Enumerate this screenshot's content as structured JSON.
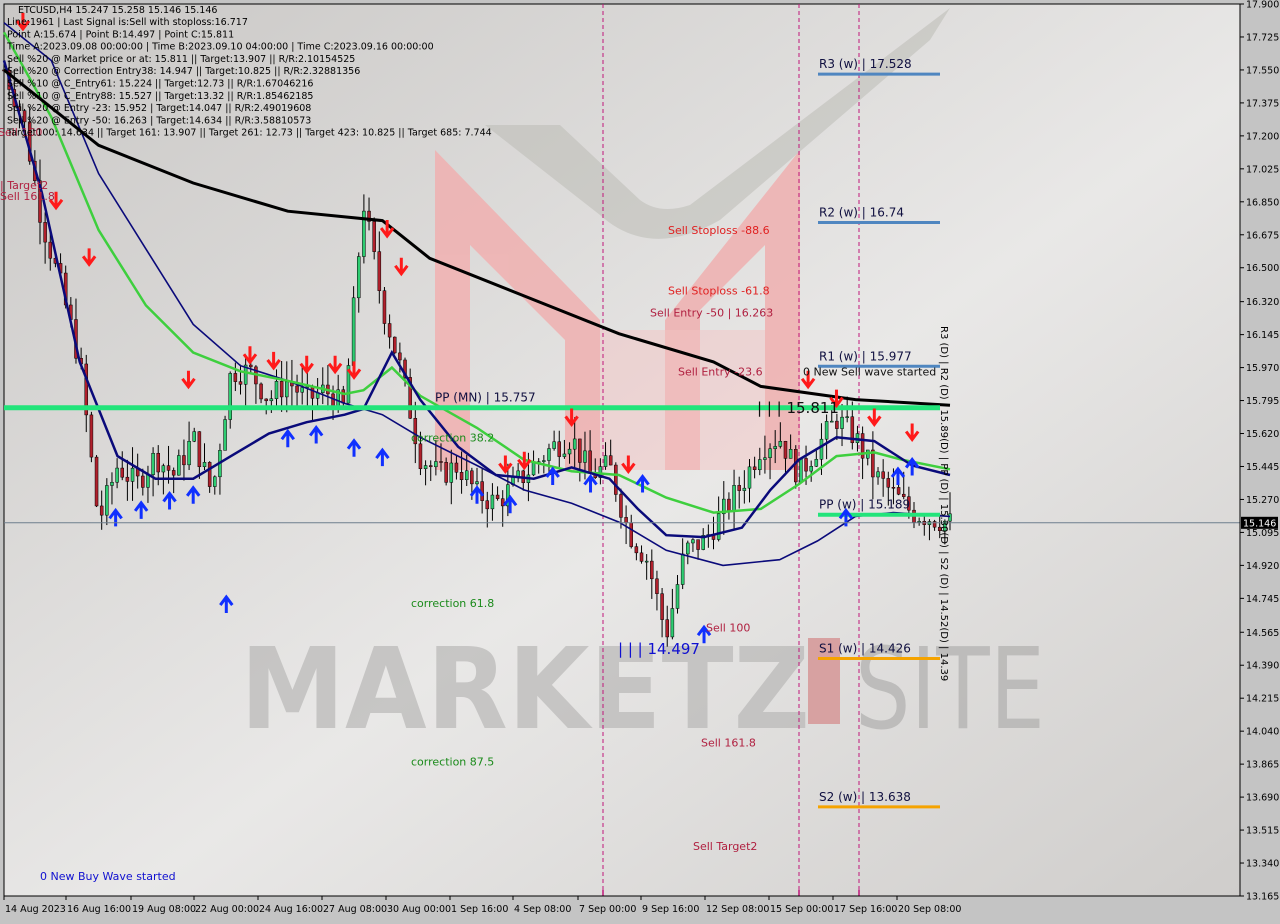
{
  "header": {
    "symbol_line": "ETCUSD,H4  15.247 15.258 15.146 15.146",
    "info_lines": [
      "Line:1961 | Last Signal is:Sell with stoploss:16.717",
      "Point A:15.674 | Point B:14.497 | Point C:15.811",
      "Time A:2023.09.08 00:00:00 | Time B:2023.09.10 04:00:00 | Time C:2023.09.16 00:00:00",
      "Sell %20 @ Market price or at: 15.811 || Target:13.907 || R/R:2.10154525",
      "Sell %20 @ Correction Entry38: 14.947 || Target:10.825 || R/R:2.32881356",
      "Sell %10 @ C_Entry61: 15.224 || Target:12.73 || R/R:1.67046216",
      "Sell %10 @ C_Entry88: 15.527 || Target:13.32 || R/R:1.85462185",
      "Sell %20 @ Entry -23: 15.952 | Target:14.047 || R/R:2.49019608",
      "Sell %20 @ Entry -50: 16.263 | Target:14.634 || R/R:3.58810573",
      "Target100: 14.634 || Target 161: 13.907 || Target 261: 12.73 || Target 423: 10.825 || Target 685: 7.744"
    ]
  },
  "watermark": {
    "left": "MARKETZ",
    "right": "SITE"
  },
  "colors": {
    "background": "#d6d4d2",
    "bull_candle": "#2ecc71",
    "bear_candle": "#b0202c",
    "ma_black": "#000000",
    "ma_navy": "#0a0a7a",
    "ma_green": "#3ecf3e",
    "pivot_weekly_r": "#4f86c0",
    "pivot_weekly_s": "#f5a300",
    "pivot_green": "#22e47a",
    "vline": "#c0167a",
    "sell_text": "#d42020",
    "correction_text": "#1a8a1a",
    "buy_text": "#1010d0",
    "current_price_bg": "#000000"
  },
  "chart_data": {
    "type": "candlestick",
    "title": "ETCUSD,H4",
    "ylim": [
      13.165,
      17.9
    ],
    "y_ticks": [
      "17.900",
      "17.725",
      "17.550",
      "17.375",
      "17.200",
      "17.025",
      "16.850",
      "16.675",
      "16.500",
      "16.320",
      "16.145",
      "15.970",
      "15.795",
      "15.620",
      "15.445",
      "15.270",
      "15.095",
      "14.920",
      "14.745",
      "14.565",
      "14.390",
      "14.215",
      "14.040",
      "13.865",
      "13.690",
      "13.515",
      "13.340",
      "13.165"
    ],
    "x_ticks": [
      "14 Aug 2023",
      "16 Aug 16:00",
      "19 Aug 08:00",
      "22 Aug 00:00",
      "24 Aug 16:00",
      "27 Aug 08:00",
      "30 Aug 00:00",
      "1 Sep 16:00",
      "4 Sep 08:00",
      "7 Sep 00:00",
      "9 Sep 16:00",
      "12 Sep 08:00",
      "15 Sep 00:00",
      "17 Sep 16:00",
      "20 Sep 08:00"
    ],
    "current_price": "15.146",
    "ohlc_last": {
      "open": 15.247,
      "high": 15.258,
      "low": 15.146,
      "close": 15.146
    },
    "close_path": [
      {
        "t": 0.0,
        "c": 17.55
      },
      {
        "t": 0.02,
        "c": 17.3
      },
      {
        "t": 0.04,
        "c": 16.75
      },
      {
        "t": 0.06,
        "c": 16.4
      },
      {
        "t": 0.08,
        "c": 16.0
      },
      {
        "t": 0.1,
        "c": 15.15
      },
      {
        "t": 0.12,
        "c": 15.45
      },
      {
        "t": 0.14,
        "c": 15.35
      },
      {
        "t": 0.16,
        "c": 15.5
      },
      {
        "t": 0.18,
        "c": 15.4
      },
      {
        "t": 0.2,
        "c": 15.6
      },
      {
        "t": 0.22,
        "c": 15.3
      },
      {
        "t": 0.24,
        "c": 15.95
      },
      {
        "t": 0.26,
        "c": 15.95
      },
      {
        "t": 0.28,
        "c": 15.8
      },
      {
        "t": 0.3,
        "c": 15.9
      },
      {
        "t": 0.32,
        "c": 15.8
      },
      {
        "t": 0.34,
        "c": 15.85
      },
      {
        "t": 0.36,
        "c": 15.75
      },
      {
        "t": 0.38,
        "c": 16.85
      },
      {
        "t": 0.4,
        "c": 16.3
      },
      {
        "t": 0.42,
        "c": 15.95
      },
      {
        "t": 0.44,
        "c": 15.5
      },
      {
        "t": 0.46,
        "c": 15.4
      },
      {
        "t": 0.48,
        "c": 15.45
      },
      {
        "t": 0.5,
        "c": 15.3
      },
      {
        "t": 0.52,
        "c": 15.25
      },
      {
        "t": 0.54,
        "c": 15.35
      },
      {
        "t": 0.56,
        "c": 15.45
      },
      {
        "t": 0.58,
        "c": 15.55
      },
      {
        "t": 0.6,
        "c": 15.6
      },
      {
        "t": 0.62,
        "c": 15.4
      },
      {
        "t": 0.64,
        "c": 15.45
      },
      {
        "t": 0.66,
        "c": 15.1
      },
      {
        "t": 0.68,
        "c": 14.95
      },
      {
        "t": 0.7,
        "c": 14.55
      },
      {
        "t": 0.72,
        "c": 15.0
      },
      {
        "t": 0.74,
        "c": 15.05
      },
      {
        "t": 0.76,
        "c": 15.2
      },
      {
        "t": 0.78,
        "c": 15.35
      },
      {
        "t": 0.8,
        "c": 15.55
      },
      {
        "t": 0.82,
        "c": 15.6
      },
      {
        "t": 0.84,
        "c": 15.4
      },
      {
        "t": 0.86,
        "c": 15.55
      },
      {
        "t": 0.88,
        "c": 15.7
      },
      {
        "t": 0.9,
        "c": 15.6
      },
      {
        "t": 0.92,
        "c": 15.4
      },
      {
        "t": 0.94,
        "c": 15.3
      },
      {
        "t": 0.96,
        "c": 15.2
      },
      {
        "t": 1.0,
        "c": 15.146
      }
    ],
    "ma_black": [
      [
        0.0,
        17.55
      ],
      [
        0.1,
        17.15
      ],
      [
        0.2,
        16.95
      ],
      [
        0.3,
        16.8
      ],
      [
        0.4,
        16.75
      ],
      [
        0.45,
        16.55
      ],
      [
        0.55,
        16.35
      ],
      [
        0.65,
        16.15
      ],
      [
        0.75,
        16.0
      ],
      [
        0.8,
        15.87
      ],
      [
        0.9,
        15.8
      ],
      [
        1.0,
        15.77
      ]
    ],
    "ma_green": [
      [
        0.0,
        17.75
      ],
      [
        0.05,
        17.3
      ],
      [
        0.1,
        16.7
      ],
      [
        0.15,
        16.3
      ],
      [
        0.2,
        16.05
      ],
      [
        0.25,
        15.95
      ],
      [
        0.3,
        15.9
      ],
      [
        0.36,
        15.83
      ],
      [
        0.38,
        15.85
      ],
      [
        0.41,
        15.97
      ],
      [
        0.44,
        15.82
      ],
      [
        0.5,
        15.65
      ],
      [
        0.55,
        15.48
      ],
      [
        0.6,
        15.42
      ],
      [
        0.65,
        15.4
      ],
      [
        0.7,
        15.28
      ],
      [
        0.75,
        15.2
      ],
      [
        0.8,
        15.22
      ],
      [
        0.84,
        15.35
      ],
      [
        0.88,
        15.5
      ],
      [
        0.92,
        15.52
      ],
      [
        0.95,
        15.48
      ],
      [
        1.0,
        15.43
      ]
    ],
    "ma_navy_fast": [
      [
        0.0,
        17.6
      ],
      [
        0.04,
        16.9
      ],
      [
        0.08,
        16.0
      ],
      [
        0.12,
        15.5
      ],
      [
        0.16,
        15.38
      ],
      [
        0.2,
        15.38
      ],
      [
        0.24,
        15.5
      ],
      [
        0.28,
        15.62
      ],
      [
        0.32,
        15.68
      ],
      [
        0.36,
        15.72
      ],
      [
        0.38,
        15.75
      ],
      [
        0.41,
        16.05
      ],
      [
        0.44,
        15.8
      ],
      [
        0.48,
        15.55
      ],
      [
        0.52,
        15.4
      ],
      [
        0.56,
        15.38
      ],
      [
        0.6,
        15.44
      ],
      [
        0.64,
        15.38
      ],
      [
        0.67,
        15.22
      ],
      [
        0.7,
        15.08
      ],
      [
        0.74,
        15.07
      ],
      [
        0.78,
        15.12
      ],
      [
        0.81,
        15.32
      ],
      [
        0.84,
        15.48
      ],
      [
        0.88,
        15.6
      ],
      [
        0.92,
        15.58
      ],
      [
        0.96,
        15.45
      ],
      [
        1.0,
        15.4
      ]
    ],
    "ma_navy_slow": [
      [
        0.0,
        17.8
      ],
      [
        0.05,
        17.6
      ],
      [
        0.1,
        17.0
      ],
      [
        0.15,
        16.6
      ],
      [
        0.2,
        16.2
      ],
      [
        0.25,
        15.98
      ],
      [
        0.3,
        15.9
      ],
      [
        0.36,
        15.78
      ],
      [
        0.4,
        15.72
      ],
      [
        0.44,
        15.6
      ],
      [
        0.5,
        15.45
      ],
      [
        0.55,
        15.32
      ],
      [
        0.6,
        15.25
      ],
      [
        0.65,
        15.15
      ],
      [
        0.7,
        15.0
      ],
      [
        0.76,
        14.92
      ],
      [
        0.82,
        14.95
      ],
      [
        0.86,
        15.05
      ],
      [
        0.9,
        15.18
      ],
      [
        0.94,
        15.2
      ],
      [
        1.0,
        15.18
      ]
    ],
    "pivot_levels": [
      {
        "label": "R3 (w) | 17.528",
        "value": 17.528,
        "kind": "weekly-r"
      },
      {
        "label": "R2 (w) | 16.74",
        "value": 16.74,
        "kind": "weekly-r"
      },
      {
        "label": "R1 (w) | 15.977",
        "value": 15.977,
        "kind": "weekly-r"
      },
      {
        "label": "PP (MN) | 15.757",
        "value": 15.757,
        "kind": "monthly-pp"
      },
      {
        "label": "PP (w) | 15.189",
        "value": 15.189,
        "kind": "weekly-pp"
      },
      {
        "label": "S1 (w) | 14.426",
        "value": 14.426,
        "kind": "weekly-s"
      },
      {
        "label": "S2 (w) | 13.638",
        "value": 13.638,
        "kind": "weekly-s"
      }
    ],
    "daily_pivot_vertical_text": "R3 (D) | R2 (D) | 15.89(D) | PP (D) | 15.30(D) | S2 (D) | 14.52(D) | 14.39",
    "annotations": [
      {
        "text": "Sell Stoploss -88.6",
        "value": 16.7,
        "kind": "sell"
      },
      {
        "text": "Sell Stoploss -61.8",
        "value": 16.38,
        "kind": "sell"
      },
      {
        "text": "Sell Entry -50 | 16.263",
        "value": 16.263,
        "kind": "sell-dark"
      },
      {
        "text": "Sell Entry -23.6",
        "value": 15.95,
        "kind": "sell-dark"
      },
      {
        "text": "| | | 15.811",
        "value": 15.75,
        "kind": "black"
      },
      {
        "text": "0 New Sell wave started",
        "value": 15.95,
        "kind": "black"
      },
      {
        "text": "correction 38.2",
        "value": 15.6,
        "kind": "correction"
      },
      {
        "text": "correction 61.8",
        "value": 14.72,
        "kind": "correction"
      },
      {
        "text": "correction 87.5",
        "value": 13.88,
        "kind": "correction"
      },
      {
        "text": "Sell 100",
        "value": 14.59,
        "kind": "sell-dark"
      },
      {
        "text": "| | | 14.497",
        "value": 14.47,
        "kind": "buy"
      },
      {
        "text": "Sell 161.8",
        "value": 13.98,
        "kind": "sell-dark"
      },
      {
        "text": "Sell Target2",
        "value": 13.43,
        "kind": "sell-dark"
      },
      {
        "text": "0 New Buy Wave started",
        "value": 13.27,
        "kind": "buy"
      },
      {
        "text": "Sell 100",
        "value": 17.22,
        "kind": "sell-dark"
      },
      {
        "text": "| Target2",
        "value": 16.94,
        "kind": "sell-dark"
      },
      {
        "text": "Sell 161.8",
        "value": 16.88,
        "kind": "sell-dark"
      }
    ],
    "vertical_markers": [
      "7 Sep 00:00",
      "15 Sep 00:00",
      "17 Sep 16:00"
    ]
  }
}
